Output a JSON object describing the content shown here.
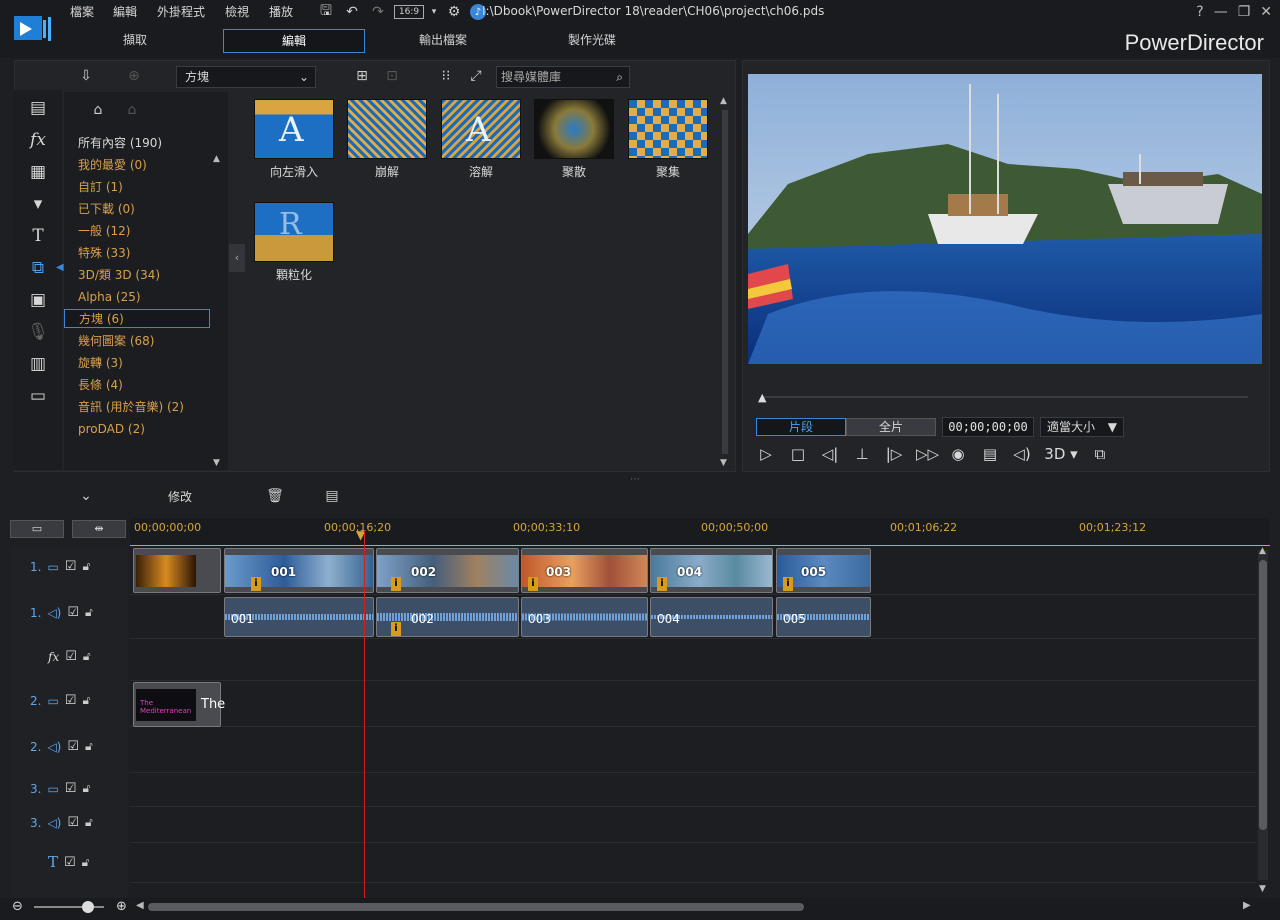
{
  "menu": [
    "檔案",
    "編輯",
    "外掛程式",
    "檢視",
    "播放"
  ],
  "path": "I:\\Dbook\\PowerDirector 18\\reader\\CH06\\project\\ch06.pds",
  "aspect": "16:9",
  "window_controls": [
    "?",
    "—",
    "❐",
    "✕"
  ],
  "mode_tabs": [
    "擷取",
    "編輯",
    "輸出檔案",
    "製作光碟"
  ],
  "active_tab": "編輯",
  "brand": "PowerDirector",
  "library": {
    "dropdown": "方塊",
    "search_placeholder": "搜尋媒體庫",
    "categories": [
      "所有內容 (190)",
      "我的最愛 (0)",
      "自訂 (1)",
      "已下載 (0)",
      "一般 (12)",
      "特殊 (33)",
      "3D/類 3D (34)",
      "Alpha (25)",
      "方塊 (6)",
      "幾何圖案 (68)",
      "旋轉 (3)",
      "長條 (4)",
      "音訊 (用於音樂) (2)",
      "proDAD (2)"
    ],
    "selected_category": "方塊 (6)",
    "transitions": [
      "向左滑入",
      "崩解",
      "溶解",
      "聚散",
      "聚集",
      "顆粒化"
    ]
  },
  "preview": {
    "mode_clip": "片段",
    "mode_movie": "全片",
    "timecode": "00;00;00;00",
    "fit": "適當大小",
    "three_d": "3D"
  },
  "timeline": {
    "modify_label": "修改",
    "ruler": [
      "00;00;00;00",
      "00;00;16;20",
      "00;00;33;10",
      "00;00;50;00",
      "00;01;06;22",
      "00;01;23;12"
    ],
    "tracks": [
      {
        "num": "1.",
        "type": "video"
      },
      {
        "num": "1.",
        "type": "audio"
      },
      {
        "num": "",
        "type": "fx"
      },
      {
        "num": "2.",
        "type": "video"
      },
      {
        "num": "2.",
        "type": "audio"
      },
      {
        "num": "3.",
        "type": "video"
      },
      {
        "num": "3.",
        "type": "audio"
      },
      {
        "num": "",
        "type": "title"
      }
    ],
    "video_clips": [
      "001",
      "002",
      "003",
      "004",
      "005"
    ],
    "audio_clips": [
      "001",
      "002",
      "003",
      "004",
      "005"
    ],
    "title_clip": "The"
  },
  "colors": {
    "accent": "#3a86d8",
    "category": "#d8a04c",
    "ruler": "#d4a63c",
    "playhead": "#d21f1f"
  }
}
